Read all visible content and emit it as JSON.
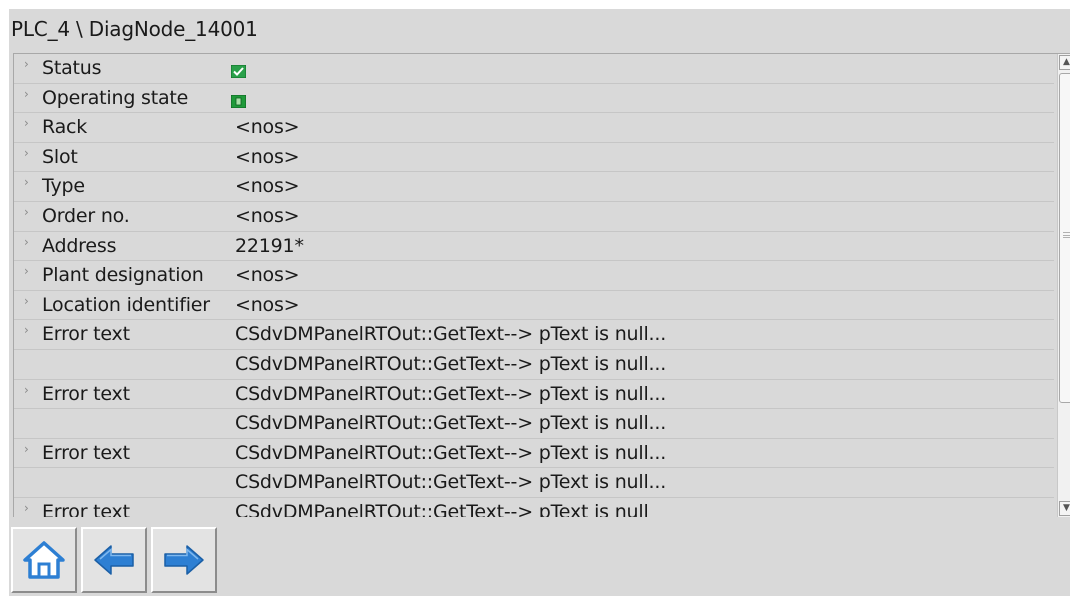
{
  "window": {
    "title": "PLC_4 \\ DiagNode_14001"
  },
  "rows": [
    {
      "label": "Status",
      "icon": "status-ok-checkmark-icon",
      "value": ""
    },
    {
      "label": "Operating state",
      "icon": "operating-state-run-icon",
      "value": ""
    },
    {
      "label": "Rack",
      "value": "<nos>"
    },
    {
      "label": "Slot",
      "value": "<nos>"
    },
    {
      "label": "Type",
      "value": "<nos>"
    },
    {
      "label": "Order no.",
      "value": "<nos>"
    },
    {
      "label": "Address",
      "value": "22191*"
    },
    {
      "label": "Plant designation",
      "value": "<nos>"
    },
    {
      "label": "Location identifier",
      "value": "<nos>"
    },
    {
      "label": "Error text",
      "value": "CSdvDMPanelRTOut::GetText--> pText is null..."
    },
    {
      "label": "",
      "value": "CSdvDMPanelRTOut::GetText--> pText is null..."
    },
    {
      "label": "Error text",
      "value": "CSdvDMPanelRTOut::GetText--> pText is null..."
    },
    {
      "label": "",
      "value": "CSdvDMPanelRTOut::GetText--> pText is null..."
    },
    {
      "label": "Error text",
      "value": "CSdvDMPanelRTOut::GetText--> pText is null..."
    },
    {
      "label": "",
      "value": "CSdvDMPanelRTOut::GetText--> pText is null..."
    },
    {
      "label": "Error text",
      "value": "CSdvDMPanelRTOut::GetText--> pText is null"
    }
  ],
  "toolbar": {
    "home_icon": "home-icon",
    "back_icon": "arrow-left-icon",
    "forward_icon": "arrow-right-icon"
  },
  "colors": {
    "panel_background": "#d9d9d9",
    "button_icon_blue": "#2d7fd3",
    "status_ok_green": "#1f9a3a"
  }
}
